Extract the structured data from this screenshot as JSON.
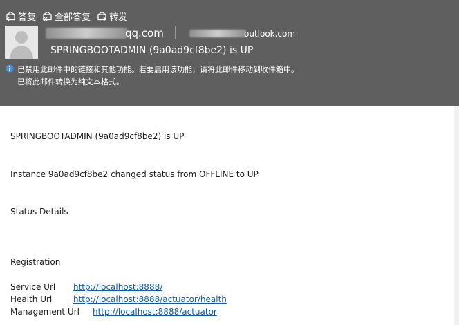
{
  "toolbar": {
    "reply": "答复",
    "reply_all": "全部答复",
    "forward": "转发"
  },
  "header": {
    "from_domain": "qq.com",
    "to_domain": "outlook.com",
    "subject": "SPRINGBOOTADMIN (9a0ad9cf8be2) is UP",
    "info_line1": "已禁用此邮件中的链接和其他功能。若要启用该功能，请将此邮件移动到收件箱中。",
    "info_line2": "已将此邮件转换为纯文本格式。"
  },
  "body": {
    "title": "SPRINGBOOTADMIN (9a0ad9cf8be2) is UP",
    "status_change": "Instance 9a0ad9cf8be2 changed status from OFFLINE to UP",
    "status_details": "Status Details",
    "registration": "Registration",
    "links": [
      {
        "label": "Service Url",
        "url": "http://localhost:8888/"
      },
      {
        "label": "Health Url",
        "url": "http://localhost:8888/actuator/health"
      },
      {
        "label": "Management Url",
        "url": "http://localhost:8888/actuator"
      }
    ]
  },
  "icons": {
    "reply": "reply-icon",
    "reply_all": "reply-all-icon",
    "forward": "forward-icon",
    "avatar": "person-avatar-icon",
    "info": "info-icon"
  },
  "colors": {
    "header_bg": "#5f5f5f",
    "link": "#0f5ba8",
    "info_icon": "#4a90d9"
  }
}
